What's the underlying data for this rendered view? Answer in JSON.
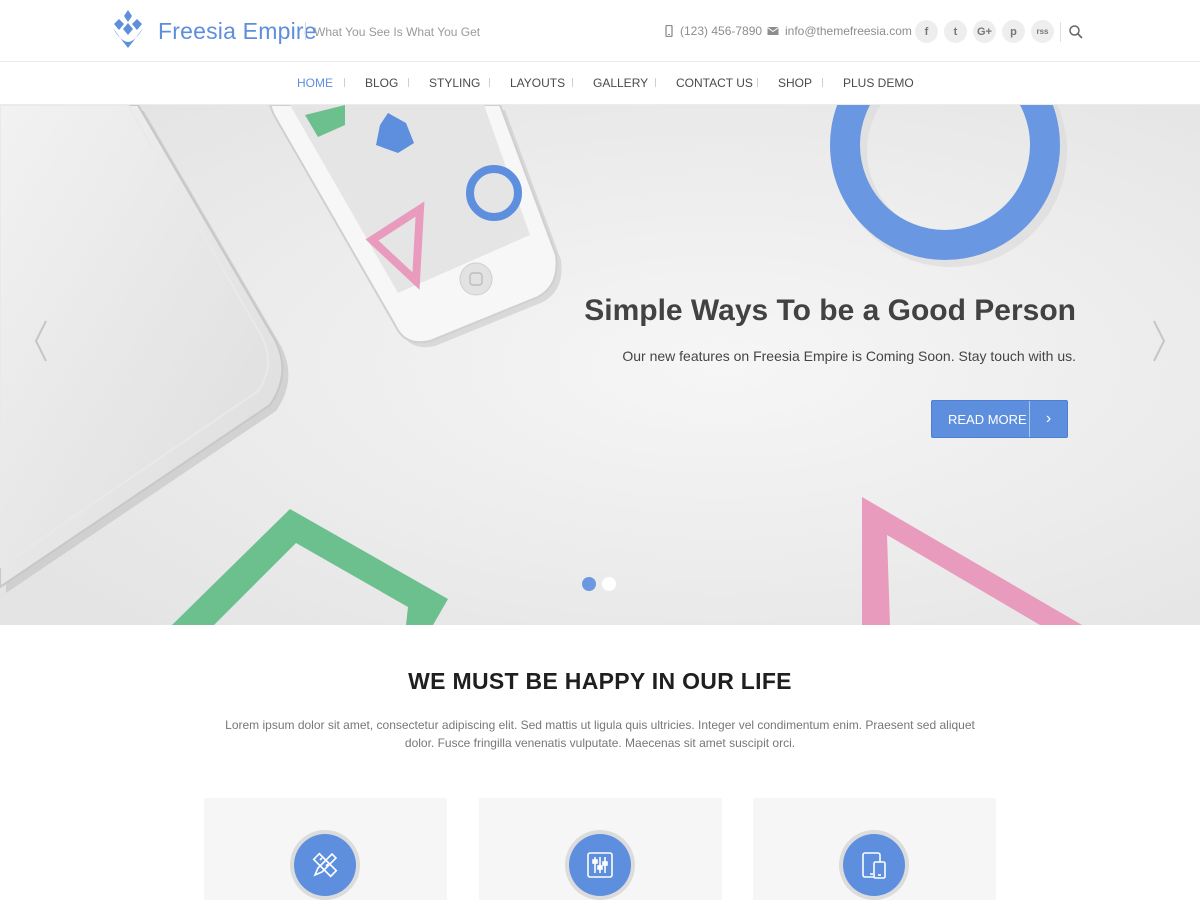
{
  "header": {
    "site_title": "Freesia Empire",
    "tagline": "What You See Is What You Get",
    "phone": "(123) 456-7890",
    "email": "info@themefreesia.com",
    "socials": [
      {
        "name": "facebook-icon",
        "glyph": "f"
      },
      {
        "name": "twitter-icon",
        "glyph": "t"
      },
      {
        "name": "google-plus-icon",
        "glyph": "G+"
      },
      {
        "name": "pinterest-icon",
        "glyph": "p"
      },
      {
        "name": "rss-icon",
        "glyph": "rss"
      }
    ]
  },
  "nav": {
    "items": [
      {
        "label": "HOME",
        "active": true
      },
      {
        "label": "BLOG"
      },
      {
        "label": "STYLING"
      },
      {
        "label": "LAYOUTS"
      },
      {
        "label": "GALLERY"
      },
      {
        "label": "CONTACT US"
      },
      {
        "label": "SHOP"
      },
      {
        "label": "PLUS DEMO"
      }
    ]
  },
  "hero": {
    "title": "Simple Ways To be a Good Person",
    "subtitle": "Our new features on Freesia Empire is Coming Soon. Stay touch with us.",
    "button_label": "READ MORE",
    "button_arrow": "›",
    "slide_count": 2,
    "active_slide": 1
  },
  "section": {
    "title": "WE MUST BE HAPPY IN OUR LIFE",
    "text": "Lorem ipsum dolor sit amet, consectetur adipiscing elit. Sed mattis ut ligula quis ultricies. Integer vel condimentum enim. Praesent sed aliquet dolor. Fusce fringilla venenatis vulputate. Maecenas sit amet suscipit orci."
  },
  "features": [
    {
      "icon": "pencil-ruler-icon"
    },
    {
      "icon": "sliders-icon"
    },
    {
      "icon": "devices-icon"
    }
  ],
  "colors": {
    "accent": "#5d8fde",
    "green_shape": "#6cc08e",
    "pink_shape": "#e89bbd",
    "hero_bg": "#ededed"
  }
}
